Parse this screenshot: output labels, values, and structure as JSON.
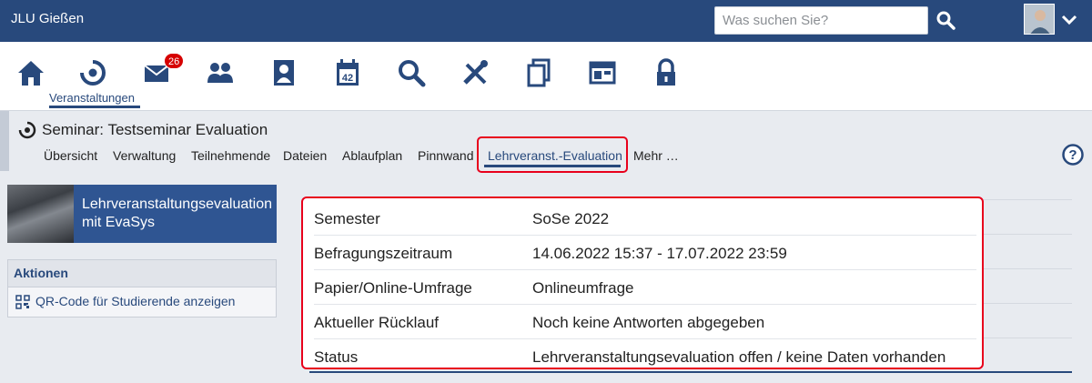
{
  "header": {
    "brand": "JLU Gießen",
    "search_placeholder": "Was suchen Sie?"
  },
  "nav": {
    "active_label": "Veranstaltungen",
    "badge": "26",
    "icons": [
      "home-icon",
      "courses-icon",
      "mail-icon",
      "community-icon",
      "profile-icon",
      "calendar-icon",
      "search-icon",
      "tools-icon",
      "files-icon",
      "admin-icon",
      "lock-icon"
    ]
  },
  "context": {
    "title": "Seminar: Testseminar Evaluation",
    "tabs": [
      "Übersicht",
      "Verwaltung",
      "Teilnehmende",
      "Dateien",
      "Ablaufplan",
      "Pinnwand",
      "Lehrveranst.-Evaluation",
      "Mehr …"
    ],
    "active_tab": "Lehrveranst.-Evaluation"
  },
  "sidebar": {
    "banner": "Lehrveranstaltungsevaluation mit EvaSys",
    "actions_title": "Aktionen",
    "actions": [
      "QR-Code für Studierende anzeigen"
    ]
  },
  "info": {
    "rows": [
      {
        "label": "Semester",
        "value": "SoSe 2022"
      },
      {
        "label": "Befragungszeitraum",
        "value": "14.06.2022 15:37 - 17.07.2022 23:59"
      },
      {
        "label": "Papier/Online-Umfrage",
        "value": "Onlineumfrage"
      },
      {
        "label": "Aktueller Rücklauf",
        "value": "Noch keine Antworten abgegeben"
      },
      {
        "label": "Status",
        "value": "Lehrveranstaltungsevaluation offen / keine Daten vorhanden"
      }
    ]
  },
  "colors": {
    "brand": "#28497c",
    "highlight": "#e8001c",
    "badge": "#d60000"
  }
}
